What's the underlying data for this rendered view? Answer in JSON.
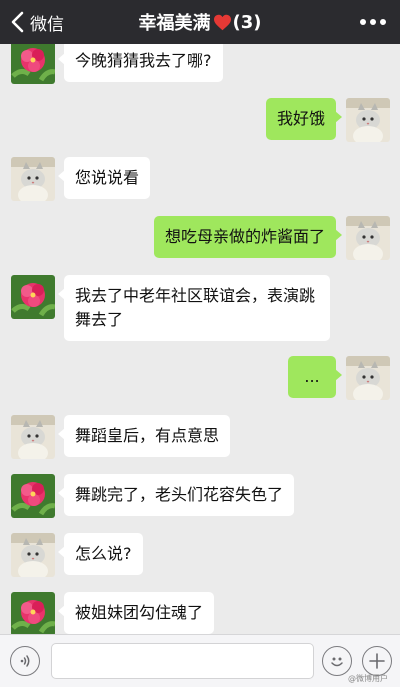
{
  "header": {
    "back_label": "微信",
    "title": "幸福美满",
    "member_count": "(3)",
    "heart_icon": "red-heart-icon",
    "more_icon": "more-dots-icon",
    "background": "#2b2b2f"
  },
  "messages": [
    {
      "side": "left",
      "sender_avatar": "flower-avatar",
      "text": "今晚猜猜我去了哪?"
    },
    {
      "side": "right",
      "sender_avatar": "cat-avatar",
      "text": "我好饿"
    },
    {
      "side": "left",
      "sender_avatar": "cat-avatar",
      "text": "您说说看"
    },
    {
      "side": "right",
      "sender_avatar": "cat-avatar",
      "text": "想吃母亲做的炸酱面了"
    },
    {
      "side": "left",
      "sender_avatar": "flower-avatar",
      "text": "我去了中老年社区联谊会，表演跳舞去了"
    },
    {
      "side": "right",
      "sender_avatar": "cat-avatar",
      "text": "..."
    },
    {
      "side": "left",
      "sender_avatar": "cat-avatar",
      "text": "舞蹈皇后，有点意思"
    },
    {
      "side": "left",
      "sender_avatar": "flower-avatar",
      "text": "舞跳完了，老头们花容失色了"
    },
    {
      "side": "left",
      "sender_avatar": "cat-avatar",
      "text": "怎么说?"
    },
    {
      "side": "left",
      "sender_avatar": "flower-avatar",
      "text": "被姐妹团勾住魂了"
    }
  ],
  "input_bar": {
    "voice_icon": "voice-icon",
    "emoji_icon": "emoji-icon",
    "plus_icon": "plus-icon",
    "text_value": "",
    "watermark": "@微博用户"
  },
  "colors": {
    "chat_background": "#ebebeb",
    "sent_bubble": "#9fe75d",
    "received_bubble": "#ffffff"
  }
}
